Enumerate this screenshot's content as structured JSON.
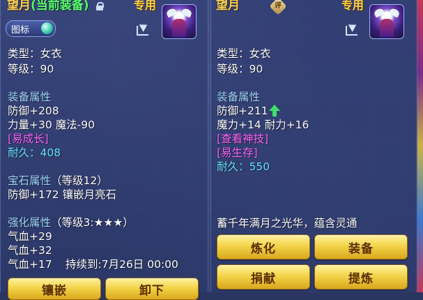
{
  "left": {
    "name": "望月",
    "name_tag": "(当前装备)",
    "exclusive": "专用",
    "icon_label": "图标",
    "type": "类型：女衣",
    "level": "等级：90",
    "equip_attr_title": "装备属性",
    "attr1": "防御+208",
    "attr2": "力量+30 魔法-90",
    "special": "[易成长]",
    "durability": "耐久：408",
    "gem_title": "宝石属性",
    "gem_level": "（等级12）",
    "gem_attr": "防御+172 镶嵌月亮石",
    "enhance_title": "强化属性",
    "enhance_level": "（等级3:★★★）",
    "enhance1": "气血+29",
    "enhance2": "气血+32",
    "enhance3": "气血+17",
    "duration": "持续到:7月26日 00:00",
    "btn_inlay": "镶嵌",
    "btn_unequip": "卸下"
  },
  "right": {
    "name": "望月",
    "badge": "评",
    "exclusive": "专用",
    "type": "类型：女衣",
    "level": "等级：90",
    "equip_attr_title": "装备属性",
    "attr1": "防御+211",
    "attr2": "魔力+14 耐力+16",
    "special1": "[查看神技]",
    "special2": "[易生存]",
    "durability": "耐久：550",
    "desc": "蓄千年满月之光华，蕴含灵通",
    "btn_refine": "炼化",
    "btn_equip": "装备",
    "btn_donate": "捐献",
    "btn_extract": "提炼"
  },
  "icons": {
    "lock": "lock-icon",
    "share": "share-icon",
    "portrait": "character-portrait",
    "up": "up-arrow-icon",
    "badge": "rating-badge-icon"
  },
  "colors": {
    "name": "#ffd24a",
    "current_equip": "#55ff66",
    "section": "#9fd8ff",
    "special": "#ff66ff",
    "durability": "#66e7ff",
    "increase": "#3fe06a",
    "button": "#f3d44a"
  }
}
